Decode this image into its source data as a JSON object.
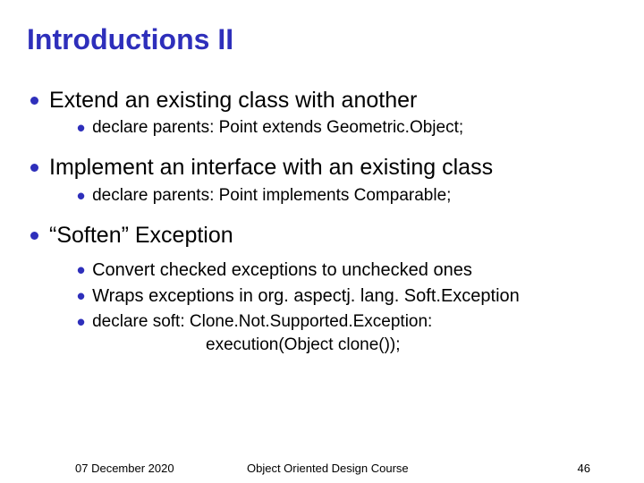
{
  "title": "Introductions II",
  "bullets": {
    "b0": {
      "text": "Extend an existing class with another",
      "subs": {
        "s0": "declare parents: Point extends Geometric.Object;"
      }
    },
    "b1": {
      "text": "Implement an interface with an existing class",
      "subs": {
        "s0": "declare parents: Point implements Comparable;"
      }
    },
    "b2": {
      "text": "“Soften” Exception",
      "subs": {
        "s0": "Convert checked exceptions to unchecked ones",
        "s1": "Wraps exceptions in org. aspectj. lang. Soft.Exception",
        "s2": "declare soft: Clone.Not.Supported.Exception:",
        "s2b": "execution(Object clone());"
      }
    }
  },
  "footer": {
    "date": "07 December 2020",
    "course": "Object Oriented Design Course",
    "page": "46"
  }
}
